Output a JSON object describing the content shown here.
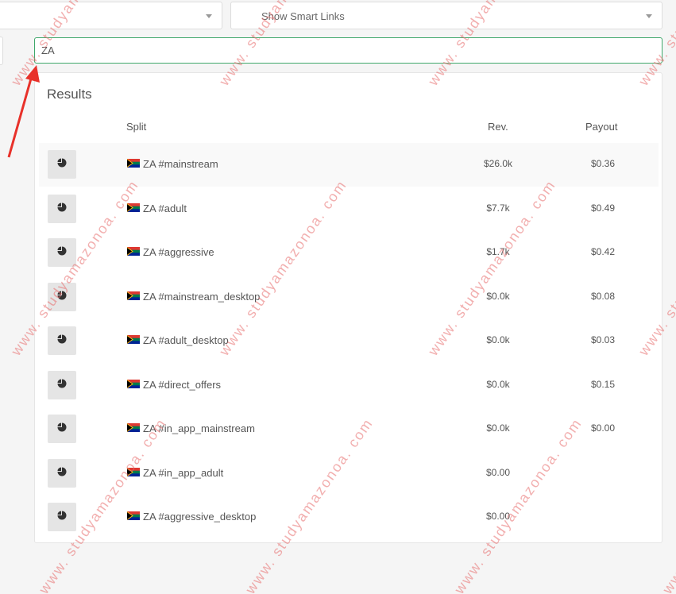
{
  "filters": {
    "left_select_value": "",
    "smart_links_select_value": "Show Smart Links"
  },
  "search": {
    "value": "ZA"
  },
  "results": {
    "title": "Results",
    "columns": {
      "split": "Split",
      "rev": "Rev.",
      "payout": "Payout"
    },
    "rows": [
      {
        "split": "ZA #mainstream",
        "rev": "$26.0k",
        "payout": "$0.36"
      },
      {
        "split": "ZA #adult",
        "rev": "$7.7k",
        "payout": "$0.49"
      },
      {
        "split": "ZA #aggressive",
        "rev": "$1.7k",
        "payout": "$0.42"
      },
      {
        "split": "ZA #mainstream_desktop",
        "rev": "$0.0k",
        "payout": "$0.08"
      },
      {
        "split": "ZA #adult_desktop",
        "rev": "$0.0k",
        "payout": "$0.03"
      },
      {
        "split": "ZA #direct_offers",
        "rev": "$0.0k",
        "payout": "$0.15"
      },
      {
        "split": "ZA #in_app_mainstream",
        "rev": "$0.0k",
        "payout": "$0.00"
      },
      {
        "split": "ZA #in_app_adult",
        "rev": "$0.00",
        "payout": ""
      },
      {
        "split": "ZA #aggressive_desktop",
        "rev": "$0.00",
        "payout": ""
      }
    ]
  },
  "watermark": "www. studyamazonoa. com",
  "colors": {
    "accent": "#3fa76a",
    "arrow": "#e8312a"
  },
  "icons": {
    "row_button": "pie-chart-icon",
    "flag": "south-africa-flag-icon"
  }
}
